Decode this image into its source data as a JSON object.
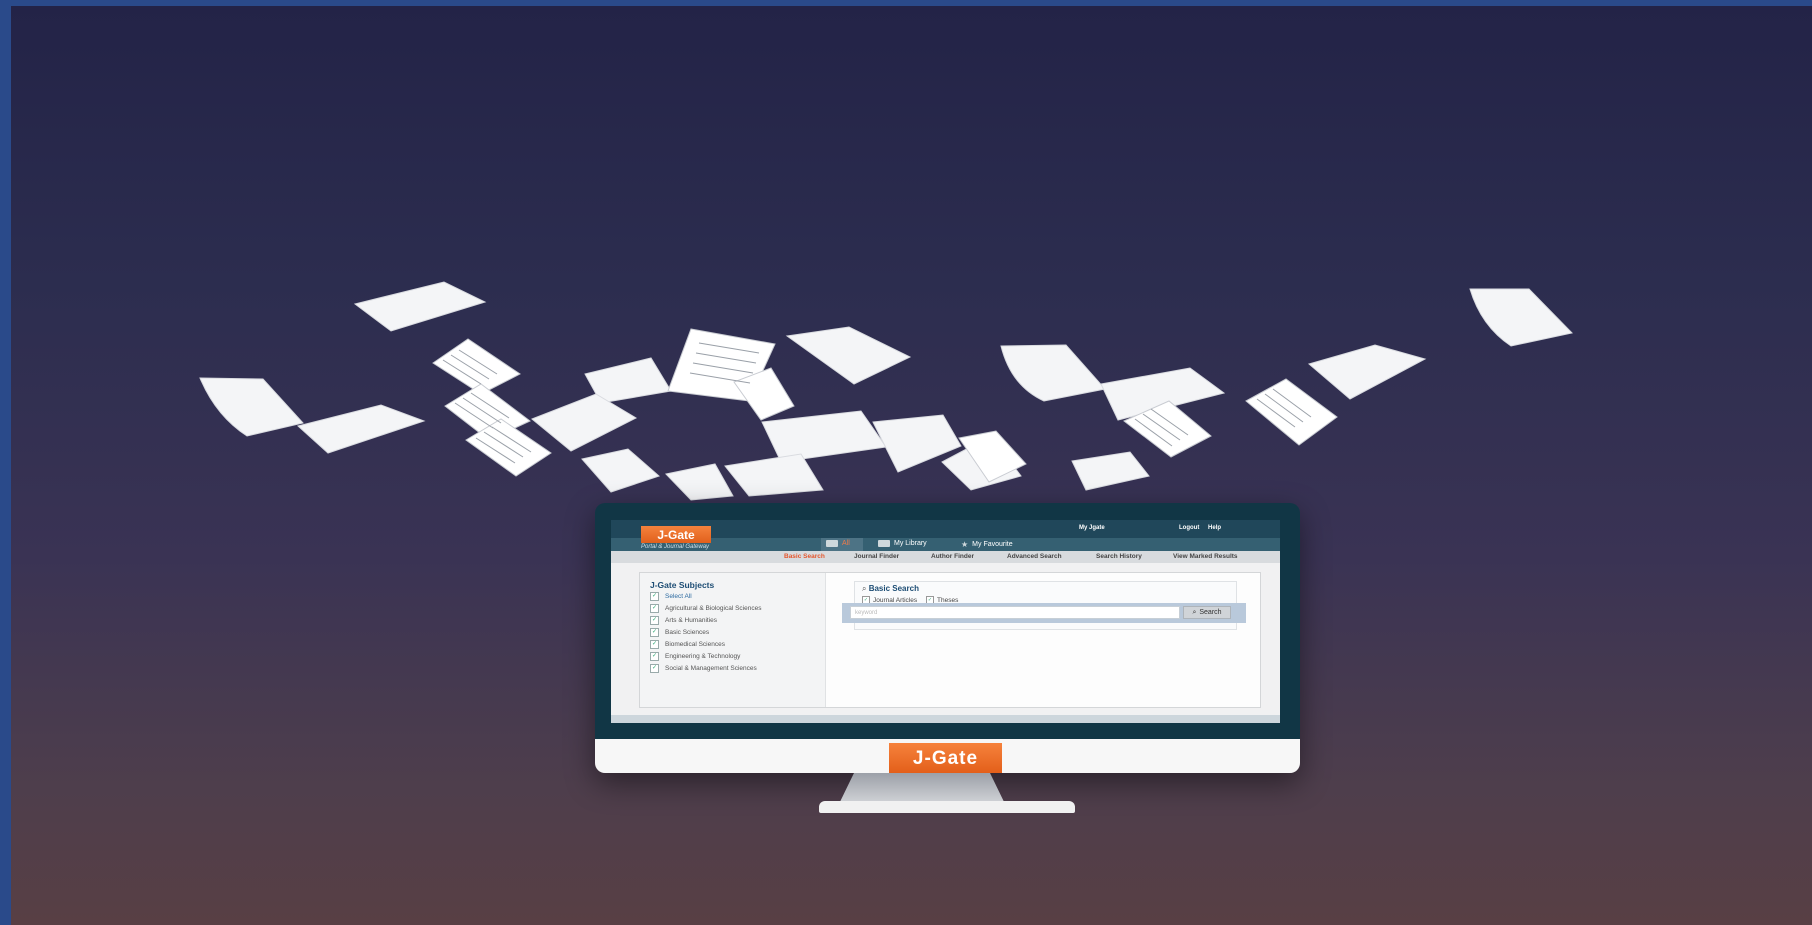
{
  "brand": {
    "logo_text": "J-Gate",
    "tagline": "Portal & Journal Gateway",
    "accent_color": "#e8661f",
    "screen_header_color": "#20475a"
  },
  "header": {
    "links": [
      "My Jgate",
      "Logout",
      "Help"
    ]
  },
  "tabs": [
    {
      "label": "All",
      "icon": "chat-icon"
    },
    {
      "label": "My Library",
      "icon": "folder-icon"
    },
    {
      "label": "My Favourite",
      "icon": "star-icon"
    }
  ],
  "subnav": {
    "items": [
      "Basic Search",
      "Journal Finder",
      "Author Finder",
      "Advanced Search",
      "Search History",
      "View Marked Results"
    ],
    "active": "Basic Search"
  },
  "subjects": {
    "title": "J-Gate Subjects",
    "items": [
      "Select All",
      "Agricultural & Biological Sciences",
      "Arts & Humanities",
      "Basic Sciences",
      "Biomedical Sciences",
      "Engineering & Technology",
      "Social & Management Sciences"
    ]
  },
  "basic_search": {
    "title": "Basic Search",
    "options": [
      "Journal Articles",
      "Theses"
    ],
    "placeholder": "keyword",
    "button_label": "Search"
  }
}
